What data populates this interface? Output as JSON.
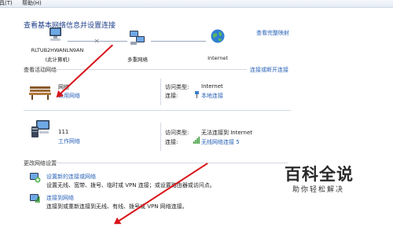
{
  "menu": {
    "tools_label": "工具(T)",
    "help_label": "帮助(H)"
  },
  "header": {
    "title": "查看基本网络信息并设置连接",
    "full_map_link": "查看完整映射"
  },
  "network_map": {
    "computer_name": "RLTUB2HWANLN9AN",
    "computer_sub": "(此计算机)",
    "middle_label": "多重网络",
    "internet_label": "Internet"
  },
  "active": {
    "section_label": "查看活动网络",
    "connect_link": "连接或断开连接",
    "networks": [
      {
        "name": "网络",
        "type_link": "公用网络",
        "access_label": "访问类型:",
        "access_value": "Internet",
        "conn_label": "连接:",
        "conn_value": "本地连接"
      },
      {
        "name": "111",
        "type_link": "工作网络",
        "access_label": "访问类型:",
        "access_value": "无法连接到 Internet",
        "conn_label": "连接:",
        "conn_value": "无线网络连接 5"
      }
    ]
  },
  "change": {
    "section_label": "更改网络设置",
    "items": [
      {
        "title": "设置新的连接或网络",
        "desc": "设置无线、宽带、拨号、临时或 VPN 连接；或设置路由器或访问点。"
      },
      {
        "title": "连接到网络",
        "desc": "连接到或重新连接到无线、有线、拨号或 VPN 网络连接。"
      }
    ]
  },
  "watermark": {
    "main": "百科全说",
    "sub": "助你轻松解决"
  },
  "colors": {
    "link": "#2a63b8",
    "title": "#1e3f8a",
    "arrow": "#d8141a"
  }
}
